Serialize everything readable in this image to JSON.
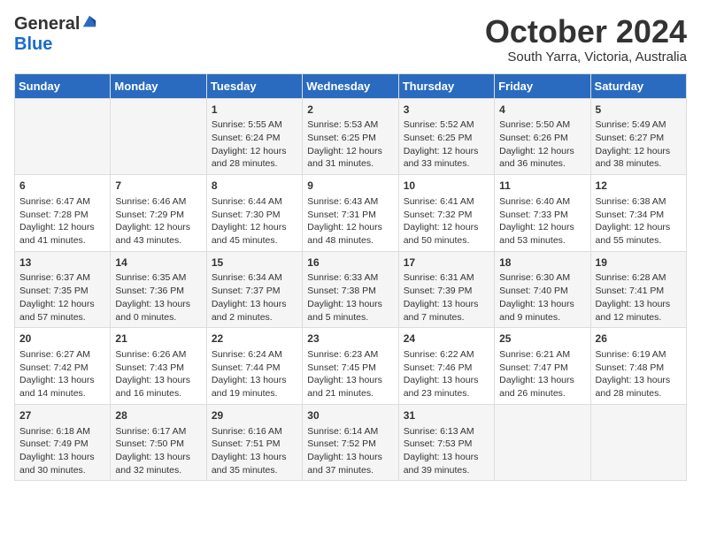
{
  "logo": {
    "general": "General",
    "blue": "Blue"
  },
  "title": "October 2024",
  "subtitle": "South Yarra, Victoria, Australia",
  "days_of_week": [
    "Sunday",
    "Monday",
    "Tuesday",
    "Wednesday",
    "Thursday",
    "Friday",
    "Saturday"
  ],
  "weeks": [
    [
      {
        "day": "",
        "info": ""
      },
      {
        "day": "",
        "info": ""
      },
      {
        "day": "1",
        "info": "Sunrise: 5:55 AM\nSunset: 6:24 PM\nDaylight: 12 hours and 28 minutes."
      },
      {
        "day": "2",
        "info": "Sunrise: 5:53 AM\nSunset: 6:25 PM\nDaylight: 12 hours and 31 minutes."
      },
      {
        "day": "3",
        "info": "Sunrise: 5:52 AM\nSunset: 6:25 PM\nDaylight: 12 hours and 33 minutes."
      },
      {
        "day": "4",
        "info": "Sunrise: 5:50 AM\nSunset: 6:26 PM\nDaylight: 12 hours and 36 minutes."
      },
      {
        "day": "5",
        "info": "Sunrise: 5:49 AM\nSunset: 6:27 PM\nDaylight: 12 hours and 38 minutes."
      }
    ],
    [
      {
        "day": "6",
        "info": "Sunrise: 6:47 AM\nSunset: 7:28 PM\nDaylight: 12 hours and 41 minutes."
      },
      {
        "day": "7",
        "info": "Sunrise: 6:46 AM\nSunset: 7:29 PM\nDaylight: 12 hours and 43 minutes."
      },
      {
        "day": "8",
        "info": "Sunrise: 6:44 AM\nSunset: 7:30 PM\nDaylight: 12 hours and 45 minutes."
      },
      {
        "day": "9",
        "info": "Sunrise: 6:43 AM\nSunset: 7:31 PM\nDaylight: 12 hours and 48 minutes."
      },
      {
        "day": "10",
        "info": "Sunrise: 6:41 AM\nSunset: 7:32 PM\nDaylight: 12 hours and 50 minutes."
      },
      {
        "day": "11",
        "info": "Sunrise: 6:40 AM\nSunset: 7:33 PM\nDaylight: 12 hours and 53 minutes."
      },
      {
        "day": "12",
        "info": "Sunrise: 6:38 AM\nSunset: 7:34 PM\nDaylight: 12 hours and 55 minutes."
      }
    ],
    [
      {
        "day": "13",
        "info": "Sunrise: 6:37 AM\nSunset: 7:35 PM\nDaylight: 12 hours and 57 minutes."
      },
      {
        "day": "14",
        "info": "Sunrise: 6:35 AM\nSunset: 7:36 PM\nDaylight: 13 hours and 0 minutes."
      },
      {
        "day": "15",
        "info": "Sunrise: 6:34 AM\nSunset: 7:37 PM\nDaylight: 13 hours and 2 minutes."
      },
      {
        "day": "16",
        "info": "Sunrise: 6:33 AM\nSunset: 7:38 PM\nDaylight: 13 hours and 5 minutes."
      },
      {
        "day": "17",
        "info": "Sunrise: 6:31 AM\nSunset: 7:39 PM\nDaylight: 13 hours and 7 minutes."
      },
      {
        "day": "18",
        "info": "Sunrise: 6:30 AM\nSunset: 7:40 PM\nDaylight: 13 hours and 9 minutes."
      },
      {
        "day": "19",
        "info": "Sunrise: 6:28 AM\nSunset: 7:41 PM\nDaylight: 13 hours and 12 minutes."
      }
    ],
    [
      {
        "day": "20",
        "info": "Sunrise: 6:27 AM\nSunset: 7:42 PM\nDaylight: 13 hours and 14 minutes."
      },
      {
        "day": "21",
        "info": "Sunrise: 6:26 AM\nSunset: 7:43 PM\nDaylight: 13 hours and 16 minutes."
      },
      {
        "day": "22",
        "info": "Sunrise: 6:24 AM\nSunset: 7:44 PM\nDaylight: 13 hours and 19 minutes."
      },
      {
        "day": "23",
        "info": "Sunrise: 6:23 AM\nSunset: 7:45 PM\nDaylight: 13 hours and 21 minutes."
      },
      {
        "day": "24",
        "info": "Sunrise: 6:22 AM\nSunset: 7:46 PM\nDaylight: 13 hours and 23 minutes."
      },
      {
        "day": "25",
        "info": "Sunrise: 6:21 AM\nSunset: 7:47 PM\nDaylight: 13 hours and 26 minutes."
      },
      {
        "day": "26",
        "info": "Sunrise: 6:19 AM\nSunset: 7:48 PM\nDaylight: 13 hours and 28 minutes."
      }
    ],
    [
      {
        "day": "27",
        "info": "Sunrise: 6:18 AM\nSunset: 7:49 PM\nDaylight: 13 hours and 30 minutes."
      },
      {
        "day": "28",
        "info": "Sunrise: 6:17 AM\nSunset: 7:50 PM\nDaylight: 13 hours and 32 minutes."
      },
      {
        "day": "29",
        "info": "Sunrise: 6:16 AM\nSunset: 7:51 PM\nDaylight: 13 hours and 35 minutes."
      },
      {
        "day": "30",
        "info": "Sunrise: 6:14 AM\nSunset: 7:52 PM\nDaylight: 13 hours and 37 minutes."
      },
      {
        "day": "31",
        "info": "Sunrise: 6:13 AM\nSunset: 7:53 PM\nDaylight: 13 hours and 39 minutes."
      },
      {
        "day": "",
        "info": ""
      },
      {
        "day": "",
        "info": ""
      }
    ]
  ]
}
